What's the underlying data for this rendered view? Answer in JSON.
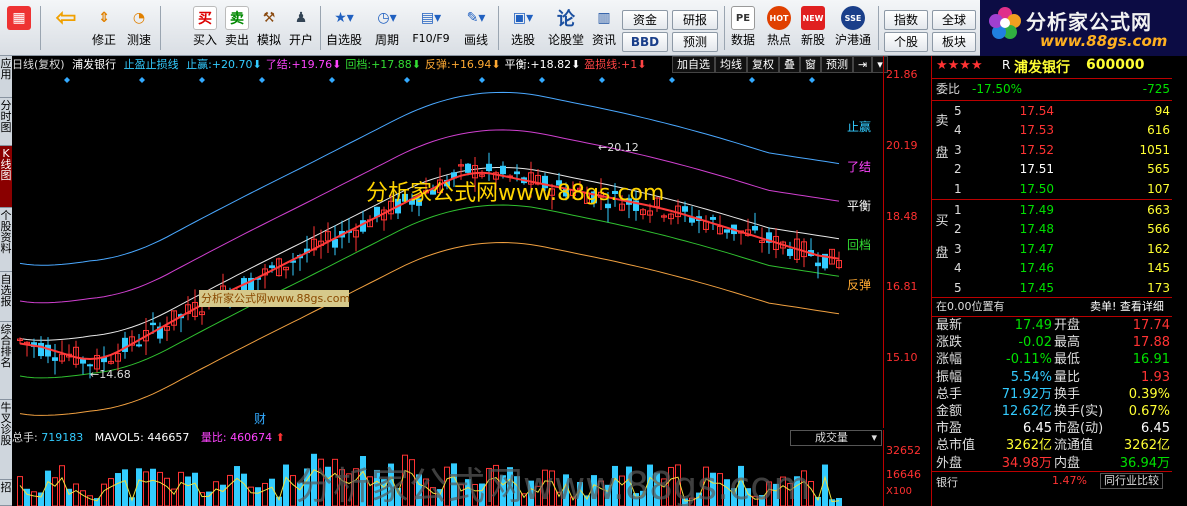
{
  "toolbar": {
    "buttons": [
      {
        "label": "",
        "icon": "grid-icon"
      },
      {
        "label": "",
        "icon": "back-arrow-icon"
      },
      {
        "label": "修正",
        "icon": "up-down-icon"
      },
      {
        "label": "测速",
        "icon": "gauge-icon"
      },
      {
        "label": "买入",
        "icon": "buy-icon",
        "glyph": "买"
      },
      {
        "label": "卖出",
        "icon": "sell-icon",
        "glyph": "卖"
      },
      {
        "label": "模拟",
        "icon": "hammer-icon"
      },
      {
        "label": "开户",
        "icon": "person-icon"
      },
      {
        "label": "自选股",
        "icon": "star-list-icon"
      },
      {
        "label": "周期",
        "icon": "clock-icon"
      },
      {
        "label": "F10/F9",
        "icon": "f10-icon"
      },
      {
        "label": "画线",
        "icon": "pen-icon"
      },
      {
        "label": "选股",
        "icon": "chart-select-icon"
      },
      {
        "label": "论股堂",
        "icon": "forum-icon",
        "glyph": "论"
      },
      {
        "label": "资讯",
        "icon": "news-icon"
      },
      {
        "label": "数据",
        "icon": "pe-icon",
        "glyph": "PE"
      },
      {
        "label": "热点",
        "icon": "hot-icon",
        "glyph": "HOT"
      },
      {
        "label": "新股",
        "icon": "new-icon",
        "glyph": "NEW"
      },
      {
        "label": "沪港通",
        "icon": "hk-connect-icon"
      }
    ],
    "small_buttons": [
      "资金",
      "研报",
      "BBD",
      "预测",
      "指数",
      "全球",
      "个股",
      "板块"
    ]
  },
  "brand": {
    "name": "分析家公式网",
    "url": "www.88gs.com"
  },
  "left_tabs": [
    "应用",
    "分时图",
    "K线图",
    "个股资料",
    "自选报",
    "综合排名",
    "牛叉诊股",
    "招"
  ],
  "chart_header": {
    "period": "日线(复权)",
    "stock": "浦发银行",
    "indicator": "止盈止损线",
    "items": [
      {
        "name": "止赢",
        "value": "+20.70",
        "color": "#33ccff"
      },
      {
        "name": "了结",
        "value": "+19.76",
        "color": "#ff44ff"
      },
      {
        "name": "回档",
        "value": "+17.88",
        "color": "#33dd33"
      },
      {
        "name": "反弹",
        "value": "+16.94",
        "color": "#ffaa33"
      },
      {
        "name": "平衡",
        "value": "+18.82",
        "color": "#ffffff"
      },
      {
        "name": "盈损线",
        "value": "+1",
        "color": "#ff4444"
      }
    ],
    "tools": [
      "加自选",
      "均线",
      "复权",
      "叠",
      "窗",
      "预测"
    ]
  },
  "price_axis": [
    "21.86",
    "20.19",
    "18.48",
    "16.81",
    "15.10"
  ],
  "line_labels": [
    "止赢",
    "了结",
    "平衡",
    "回档",
    "反弹"
  ],
  "annotations": {
    "high": "20.12",
    "low": "14.68",
    "cai": "财"
  },
  "watermarks": {
    "main": "分析家公式网www.88gs.com",
    "box": "分析家公式网www.88gs.com",
    "bottom": "分析家公式网www.88gs.com"
  },
  "volume": {
    "label_total": "总手",
    "total": "719183",
    "label_ma": "MAVOL5",
    "ma": "446657",
    "label_ratio": "量比",
    "ratio": "460674",
    "select": "成交量",
    "axis": [
      "32652",
      "16646",
      "X100"
    ]
  },
  "quote": {
    "stars": "★★★★",
    "prefix": "R",
    "name": "浦发银行",
    "code": "600000",
    "weibi_label": "委比",
    "weibi": "-17.50%",
    "weicha": "-725",
    "sell_label": "卖盘",
    "buy_label": "买盘",
    "sell": [
      {
        "n": "5",
        "price": "17.54",
        "vol": "94",
        "pc": "red"
      },
      {
        "n": "4",
        "price": "17.53",
        "vol": "616",
        "pc": "red"
      },
      {
        "n": "3",
        "price": "17.52",
        "vol": "1051",
        "pc": "red"
      },
      {
        "n": "2",
        "price": "17.51",
        "vol": "565",
        "pc": "white"
      },
      {
        "n": "1",
        "price": "17.50",
        "vol": "107",
        "pc": "green"
      }
    ],
    "buy": [
      {
        "n": "1",
        "price": "17.49",
        "vol": "663"
      },
      {
        "n": "2",
        "price": "17.48",
        "vol": "566"
      },
      {
        "n": "3",
        "price": "17.47",
        "vol": "162"
      },
      {
        "n": "4",
        "price": "17.46",
        "vol": "145"
      },
      {
        "n": "5",
        "price": "17.45",
        "vol": "173"
      }
    ],
    "status_left": "在0.00位置有",
    "status_right": "卖单! 查看详细",
    "stats": [
      {
        "l1": "最新",
        "v1": "17.49",
        "c1": "green",
        "l2": "开盘",
        "v2": "17.74",
        "c2": "red"
      },
      {
        "l1": "涨跌",
        "v1": "-0.02",
        "c1": "green",
        "l2": "最高",
        "v2": "17.88",
        "c2": "red"
      },
      {
        "l1": "涨幅",
        "v1": "-0.11%",
        "c1": "green",
        "l2": "最低",
        "v2": "16.91",
        "c2": "green"
      },
      {
        "l1": "振幅",
        "v1": "5.54%",
        "c1": "cyan",
        "l2": "量比",
        "v2": "1.93",
        "c2": "red"
      },
      {
        "l1": "总手",
        "v1": "71.92万",
        "c1": "cyan",
        "l2": "换手",
        "v2": "0.39%",
        "c2": "yellow"
      },
      {
        "l1": "金额",
        "v1": "12.62亿",
        "c1": "cyan",
        "l2": "换手(实)",
        "v2": "0.67%",
        "c2": "yellow"
      },
      {
        "l1": "市盈",
        "v1": "6.45",
        "c1": "white",
        "l2": "市盈(动)",
        "v2": "6.45",
        "c2": "white"
      },
      {
        "l1": "总市值",
        "v1": "3262亿",
        "c1": "yellow",
        "l2": "流通值",
        "v2": "3262亿",
        "c2": "yellow"
      },
      {
        "l1": "外盘",
        "v1": "34.98万",
        "c1": "red",
        "l2": "内盘",
        "v2": "36.94万",
        "c2": "green"
      }
    ],
    "footer_label": "银行",
    "footer_value": "1.47%",
    "footer_button": "同行业比较"
  },
  "colors": {
    "up": "#ff3333",
    "down": "#33ccff",
    "axis": "#bb0000"
  }
}
